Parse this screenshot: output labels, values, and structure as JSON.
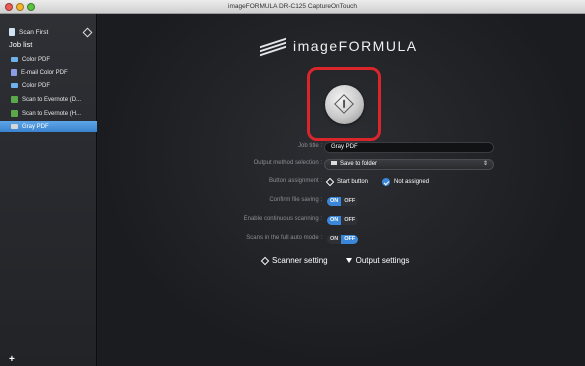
{
  "window": {
    "title": "imageFORMULA DR-C125 CaptureOnTouch"
  },
  "sidebar": {
    "scan_first": "Scan First",
    "job_list_label": "Job list",
    "items": [
      {
        "label": "Color PDF",
        "icon": "folder-icon"
      },
      {
        "label": "E-mail Color PDF",
        "icon": "email-icon"
      },
      {
        "label": "Color PDF",
        "icon": "folder-icon"
      },
      {
        "label": "Scan to Evernote (D...",
        "icon": "evernote-icon"
      },
      {
        "label": "Scan to Evernote (H...",
        "icon": "evernote-icon"
      },
      {
        "label": "Gray PDF",
        "icon": "folder-icon",
        "selected": true
      }
    ],
    "add_button": "+"
  },
  "main": {
    "logo_text": "imageFORMULA",
    "job_title_label": "Job title :",
    "job_title_value": "Gray PDF",
    "output_method_label": "Output method selection :",
    "output_method_value": "Save to folder",
    "button_assignment_label": "Button assignment :",
    "button_assignment_start": "Start button",
    "button_assignment_not": "Not assigned",
    "confirm_label": "Confirm file saving :",
    "continuous_label": "Enable continuous scanning :",
    "full_auto_label": "Scans in the full auto mode :",
    "on": "ON",
    "off": "OFF",
    "scanner_setting": "Scanner setting",
    "output_settings": "Output settings"
  },
  "colors": {
    "accent": "#3a86d8",
    "highlight_border": "#d9262b",
    "background": "#1c1d20"
  }
}
